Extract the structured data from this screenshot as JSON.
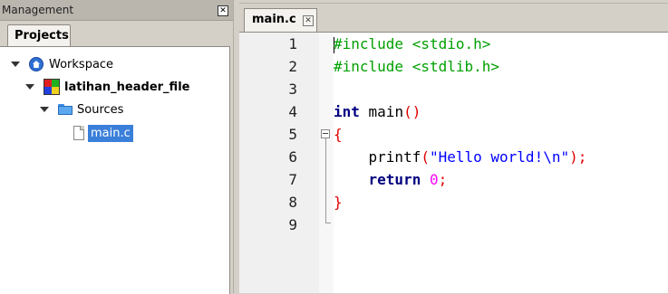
{
  "management": {
    "title": "Management",
    "close_glyph": "✕",
    "tab_label": "Projects",
    "tree": {
      "workspace": "Workspace",
      "project": "latihan_header_file",
      "folder": "Sources",
      "file": "main.c"
    }
  },
  "editor": {
    "tab_label": "main.c",
    "tab_close_glyph": "✕",
    "line_numbers": [
      "1",
      "2",
      "3",
      "4",
      "5",
      "6",
      "7",
      "8",
      "9"
    ],
    "lines": [
      [
        {
          "t": "#include <stdio.h>",
          "c": "pp"
        }
      ],
      [
        {
          "t": "#include <stdlib.h>",
          "c": "pp"
        }
      ],
      [],
      [
        {
          "t": "int",
          "c": "kw"
        },
        {
          "t": " main",
          "c": "tx"
        },
        {
          "t": "()",
          "c": "par"
        }
      ],
      [
        {
          "t": "{",
          "c": "par"
        }
      ],
      [
        {
          "t": "    printf",
          "c": "tx"
        },
        {
          "t": "(",
          "c": "par"
        },
        {
          "t": "\"Hello world!\\n\"",
          "c": "str"
        },
        {
          "t": ");",
          "c": "par"
        }
      ],
      [
        {
          "t": "    ",
          "c": "tx"
        },
        {
          "t": "return",
          "c": "kw"
        },
        {
          "t": " ",
          "c": "tx"
        },
        {
          "t": "0",
          "c": "num"
        },
        {
          "t": ";",
          "c": "par"
        }
      ],
      [
        {
          "t": "}",
          "c": "par"
        }
      ],
      []
    ]
  },
  "colors": {
    "selection": "#3a7fd9",
    "preprocessor": "#00a000",
    "keyword": "#000080",
    "operator": "#e00000",
    "string": "#0000ff",
    "number": "#ff00ff"
  },
  "icons": {
    "workspace": "workspace-icon",
    "project": "project-icon",
    "folder": "folder-icon",
    "file": "file-icon"
  }
}
